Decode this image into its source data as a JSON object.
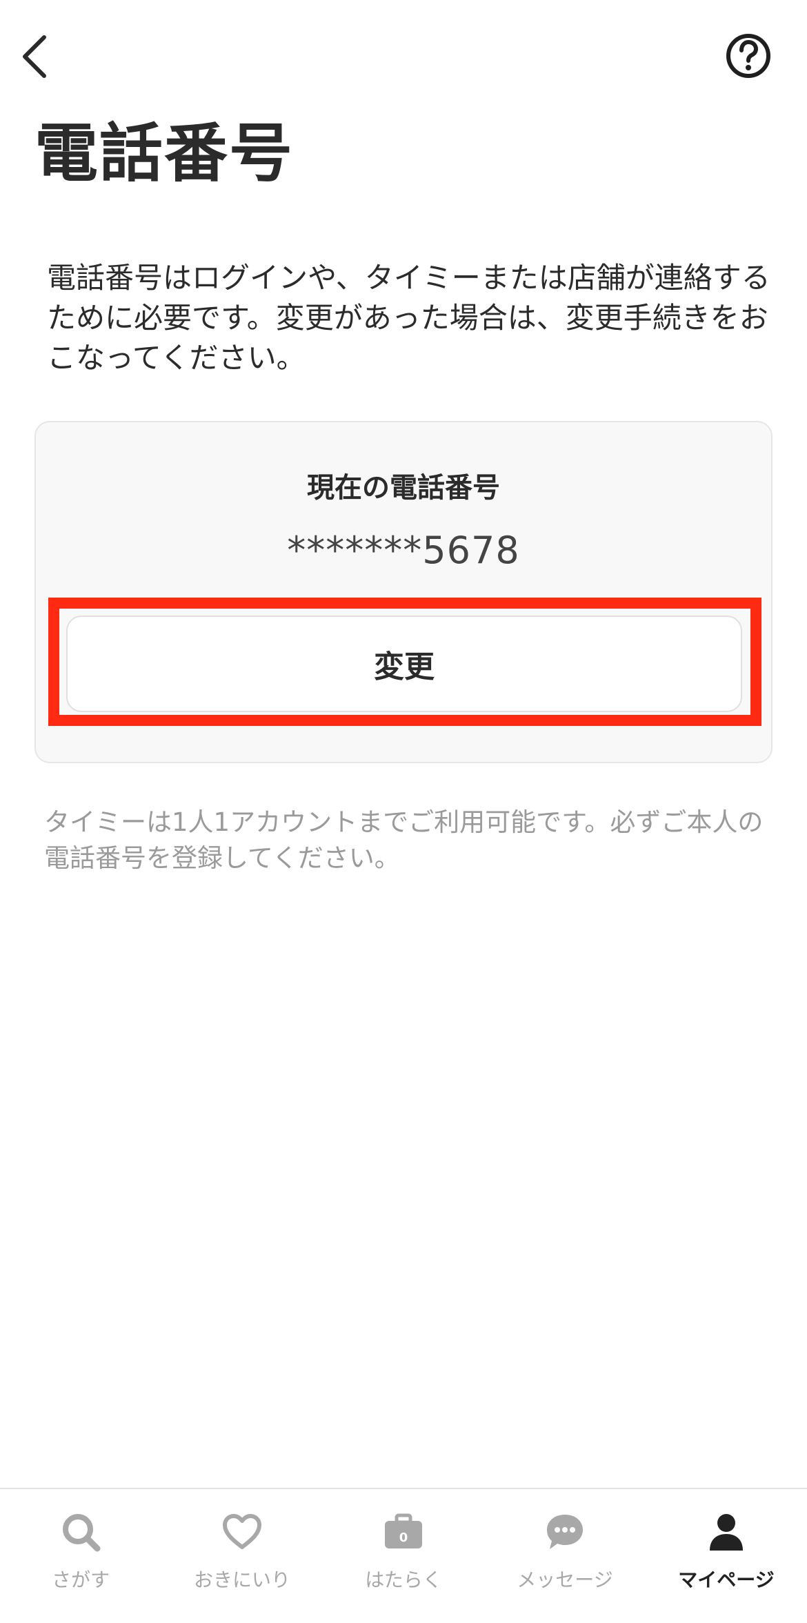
{
  "header": {
    "back_icon": "chevron-left-icon",
    "help_icon": "question-circle-icon"
  },
  "page": {
    "title": "電話番号",
    "description": "電話番号はログインや、タイミーまたは店舗が連絡するために必要です。変更があった場合は、変更手続きをおこなってください。"
  },
  "phone_card": {
    "label": "現在の電話番号",
    "masked_number": "*******5678",
    "change_button_label": "変更"
  },
  "notice": "タイミーは1人1アカウントまでご利用可能です。必ずご本人の電話番号を登録してください。",
  "tabbar": {
    "items": [
      {
        "label": "さがす",
        "icon": "search-icon",
        "active": false
      },
      {
        "label": "おきにいり",
        "icon": "heart-icon",
        "active": false
      },
      {
        "label": "はたらく",
        "icon": "briefcase-icon",
        "badge": "0",
        "active": false
      },
      {
        "label": "メッセージ",
        "icon": "chat-bubble-icon",
        "active": false
      },
      {
        "label": "マイページ",
        "icon": "person-icon",
        "active": true
      }
    ]
  },
  "colors": {
    "text": "#2b2b2b",
    "muted": "#9a9a9a",
    "highlight": "#ff2a12",
    "card_background": "#f8f8f8",
    "tab_inactive": "#a8a8a8",
    "tab_active": "#222222"
  }
}
